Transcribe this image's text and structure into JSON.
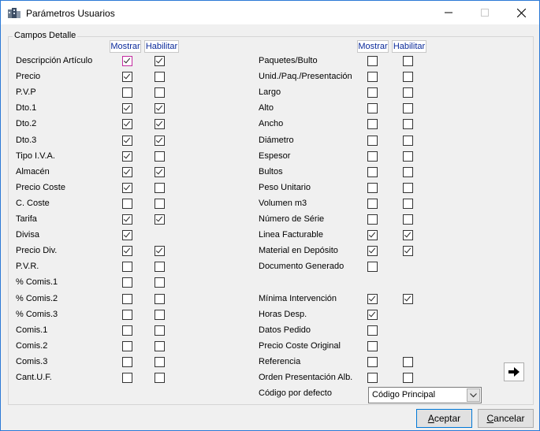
{
  "window": {
    "title": "Parámetros Usuarios"
  },
  "group": {
    "label": "Campos Detalle"
  },
  "headers": {
    "show": "Mostrar",
    "enable": "Habilitar"
  },
  "left": [
    {
      "label": "Descripción Artículo",
      "show": true,
      "enable": true
    },
    {
      "label": "Precio",
      "show": true,
      "enable": false
    },
    {
      "label": "P.V.P",
      "show": false,
      "enable": false
    },
    {
      "label": "Dto.1",
      "show": true,
      "enable": true
    },
    {
      "label": "Dto.2",
      "show": true,
      "enable": true
    },
    {
      "label": "Dto.3",
      "show": true,
      "enable": true
    },
    {
      "label": "Tipo I.V.A.",
      "show": true,
      "enable": false
    },
    {
      "label": "Almacén",
      "show": true,
      "enable": true
    },
    {
      "label": "Precio Coste",
      "show": true,
      "enable": false
    },
    {
      "label": "C. Coste",
      "show": false,
      "enable": false
    },
    {
      "label": "Tarifa",
      "show": true,
      "enable": true
    },
    {
      "label": "Divisa",
      "show": true,
      "enable": null
    },
    {
      "label": "Precio Div.",
      "show": true,
      "enable": true
    },
    {
      "label": "P.V.R.",
      "show": false,
      "enable": false
    },
    {
      "label": "% Comis.1",
      "show": false,
      "enable": false
    },
    {
      "label": "% Comis.2",
      "show": false,
      "enable": false
    },
    {
      "label": "% Comis.3",
      "show": false,
      "enable": false
    },
    {
      "label": "Comis.1",
      "show": false,
      "enable": false
    },
    {
      "label": "Comis.2",
      "show": false,
      "enable": false
    },
    {
      "label": "Comis.3",
      "show": false,
      "enable": false
    },
    {
      "label": "Cant.U.F.",
      "show": false,
      "enable": false
    }
  ],
  "right": [
    {
      "label": "Paquetes/Bulto",
      "show": false,
      "enable": false
    },
    {
      "label": "Unid./Paq./Presentación",
      "show": false,
      "enable": false
    },
    {
      "label": "Largo",
      "show": false,
      "enable": false
    },
    {
      "label": "Alto",
      "show": false,
      "enable": false
    },
    {
      "label": "Ancho",
      "show": false,
      "enable": false
    },
    {
      "label": "Diámetro",
      "show": false,
      "enable": false
    },
    {
      "label": "Espesor",
      "show": false,
      "enable": false
    },
    {
      "label": "Bultos",
      "show": false,
      "enable": false
    },
    {
      "label": "Peso Unitario",
      "show": false,
      "enable": false
    },
    {
      "label": "Volumen m3",
      "show": false,
      "enable": false
    },
    {
      "label": "Número de Série",
      "show": false,
      "enable": false
    },
    {
      "label": "Linea Facturable",
      "show": true,
      "enable": true
    },
    {
      "label": "Material en Depósito",
      "show": true,
      "enable": true
    },
    {
      "label": "Documento Generado",
      "show": false,
      "enable": null
    },
    {
      "label": "",
      "show": null,
      "enable": null
    },
    {
      "label": "Mínima Intervención",
      "show": true,
      "enable": true
    },
    {
      "label": "Horas Desp.",
      "show": true,
      "enable": null
    },
    {
      "label": "Datos Pedido",
      "show": false,
      "enable": null
    },
    {
      "label": "Precio Coste Original",
      "show": false,
      "enable": null
    },
    {
      "label": "Referencia",
      "show": false,
      "enable": false
    },
    {
      "label": "Orden Presentación Alb.",
      "show": false,
      "enable": false
    }
  ],
  "default_code": {
    "label": "Código por defecto",
    "value": "Código Principal"
  },
  "buttons": {
    "accept_first": "A",
    "accept_rest": "ceptar",
    "cancel_first": "C",
    "cancel_rest": "ancelar"
  }
}
